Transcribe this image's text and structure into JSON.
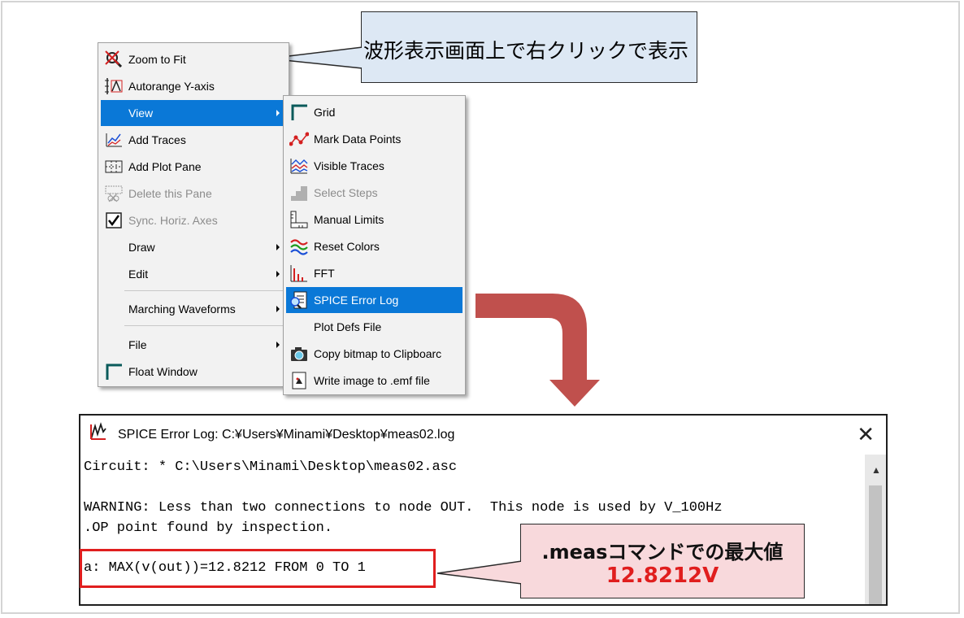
{
  "callout_top": "波形表示画面上で右クリックで表示",
  "callout_bottom": {
    "line1": ".measコマンドでの最大値",
    "line2": "12.8212V",
    "value_color": "#e01e1e"
  },
  "main_menu": {
    "items": [
      {
        "label": "Zoom to Fit",
        "icon": "zoom-fit-icon"
      },
      {
        "label": "Autorange Y-axis",
        "icon": "autorange-icon"
      },
      {
        "label": "View",
        "submenu": true
      },
      {
        "label": "Add Traces",
        "icon": "add-traces-icon"
      },
      {
        "label": "Add Plot Pane",
        "icon": "plot-pane-icon"
      },
      {
        "label": "Delete this Pane",
        "icon": "delete-pane-icon",
        "disabled": true
      },
      {
        "label": "Sync. Horiz. Axes",
        "icon": "checkbox-icon",
        "checked": true,
        "disabled": true
      },
      {
        "label": "Draw",
        "submenu": true
      },
      {
        "label": "Edit",
        "submenu": true
      },
      {
        "label": "Marching Waveforms",
        "submenu": true
      },
      {
        "label": "File",
        "submenu": true
      },
      {
        "label": "Float Window",
        "icon": "float-window-icon"
      }
    ]
  },
  "view_submenu": {
    "items": [
      {
        "label": "Grid",
        "icon": "grid-icon"
      },
      {
        "label": "Mark Data Points",
        "icon": "data-points-icon"
      },
      {
        "label": "Visible Traces",
        "icon": "visible-traces-icon"
      },
      {
        "label": "Select Steps",
        "icon": "steps-icon",
        "disabled": true
      },
      {
        "label": "Manual Limits",
        "icon": "ruler-icon"
      },
      {
        "label": "Reset Colors",
        "icon": "colors-icon"
      },
      {
        "label": "FFT",
        "icon": "fft-icon"
      },
      {
        "label": "SPICE Error Log",
        "icon": "error-log-icon",
        "highlighted": true
      },
      {
        "label": "Plot Defs File"
      },
      {
        "label": "Copy bitmap to Clipboarc",
        "icon": "camera-icon"
      },
      {
        "label": "Write image to .emf file",
        "icon": "emf-icon"
      }
    ]
  },
  "log_window": {
    "title": "SPICE Error Log: C:¥Users¥Minami¥Desktop¥meas02.log",
    "close": "✕",
    "lines": [
      "Circuit: * C:\\Users\\Minami\\Desktop\\meas02.asc",
      "WARNING: Less than two connections to node OUT.  This node is used by V_100Hz",
      ".OP point found by inspection.",
      "a: MAX(v(out))=12.8212 FROM 0 TO 1"
    ]
  },
  "colors": {
    "highlight": "#0a78d7",
    "arrow": "#c0504d",
    "callout_blue": "#dde8f4",
    "callout_pink": "#f8d9dc"
  }
}
